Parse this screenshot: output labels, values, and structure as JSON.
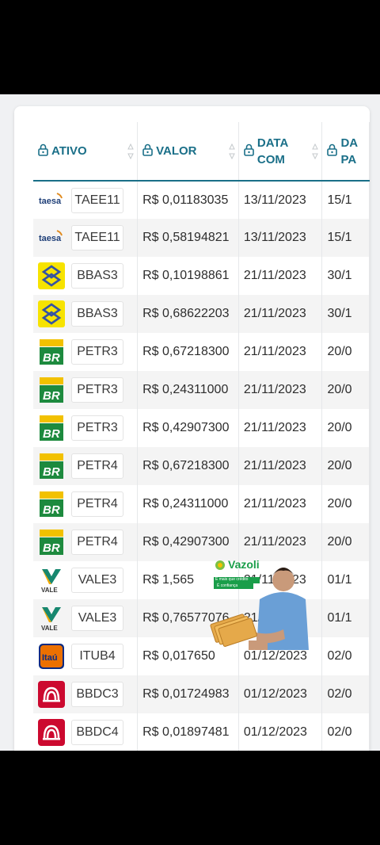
{
  "header": {
    "col_asset": "ATIVO",
    "col_value": "VALOR",
    "col_datacom_line1": "DATA",
    "col_datacom_line2": "COM",
    "col_pay_line1": "DA",
    "col_pay_line2": "PA"
  },
  "rows": [
    {
      "logo": "taesa",
      "logo_text": "taesa",
      "ticker": "TAEE11",
      "value": "R$ 0,01183035",
      "date_com": "13/11/2023",
      "pay": "15/1"
    },
    {
      "logo": "taesa",
      "logo_text": "taesa",
      "ticker": "TAEE11",
      "value": "R$ 0,58194821",
      "date_com": "13/11/2023",
      "pay": "15/1"
    },
    {
      "logo": "bb",
      "logo_text": "",
      "ticker": "BBAS3",
      "value": "R$ 0,10198861",
      "date_com": "21/11/2023",
      "pay": "30/1"
    },
    {
      "logo": "bb",
      "logo_text": "",
      "ticker": "BBAS3",
      "value": "R$ 0,68622203",
      "date_com": "21/11/2023",
      "pay": "30/1"
    },
    {
      "logo": "br",
      "logo_text": "BR",
      "ticker": "PETR3",
      "value": "R$ 0,67218300",
      "date_com": "21/11/2023",
      "pay": "20/0"
    },
    {
      "logo": "br",
      "logo_text": "BR",
      "ticker": "PETR3",
      "value": "R$ 0,24311000",
      "date_com": "21/11/2023",
      "pay": "20/0"
    },
    {
      "logo": "br",
      "logo_text": "BR",
      "ticker": "PETR3",
      "value": "R$ 0,42907300",
      "date_com": "21/11/2023",
      "pay": "20/0"
    },
    {
      "logo": "br",
      "logo_text": "BR",
      "ticker": "PETR4",
      "value": "R$ 0,67218300",
      "date_com": "21/11/2023",
      "pay": "20/0"
    },
    {
      "logo": "br",
      "logo_text": "BR",
      "ticker": "PETR4",
      "value": "R$ 0,24311000",
      "date_com": "21/11/2023",
      "pay": "20/0"
    },
    {
      "logo": "br",
      "logo_text": "BR",
      "ticker": "PETR4",
      "value": "R$ 0,42907300",
      "date_com": "21/11/2023",
      "pay": "20/0"
    },
    {
      "logo": "vale",
      "logo_text": "VALE",
      "ticker": "VALE3",
      "value": "R$ 1,565",
      "date_com": "21/11/2023",
      "pay": "01/1"
    },
    {
      "logo": "vale",
      "logo_text": "VALE",
      "ticker": "VALE3",
      "value": "R$ 0,76577076",
      "date_com": "21/11/2023",
      "pay": "01/1"
    },
    {
      "logo": "itau",
      "logo_text": "Itaú",
      "ticker": "ITUB4",
      "value": "R$ 0,017650",
      "date_com": "01/12/2023",
      "pay": "02/0"
    },
    {
      "logo": "bradesco",
      "logo_text": "",
      "ticker": "BBDC3",
      "value": "R$ 0,01724983",
      "date_com": "01/12/2023",
      "pay": "02/0"
    },
    {
      "logo": "bradesco",
      "logo_text": "",
      "ticker": "BBDC4",
      "value": "R$ 0,01897481",
      "date_com": "01/12/2023",
      "pay": "02/0"
    }
  ],
  "ad": {
    "brand": "Vazoli",
    "tagline_1": "É mais que crédito",
    "tagline_2": "É confiança"
  },
  "colors": {
    "header_accent": "#1a6f88",
    "petrobras_green": "#1d8a3e",
    "petrobras_yellow": "#f2c100",
    "bb_yellow": "#f7e300",
    "bb_blue": "#3553a3",
    "vale_green": "#17876f",
    "vale_yellow": "#f2a900",
    "itau_blue": "#0a2a82",
    "itau_orange": "#ec7000",
    "bradesco_red": "#cc092f"
  }
}
